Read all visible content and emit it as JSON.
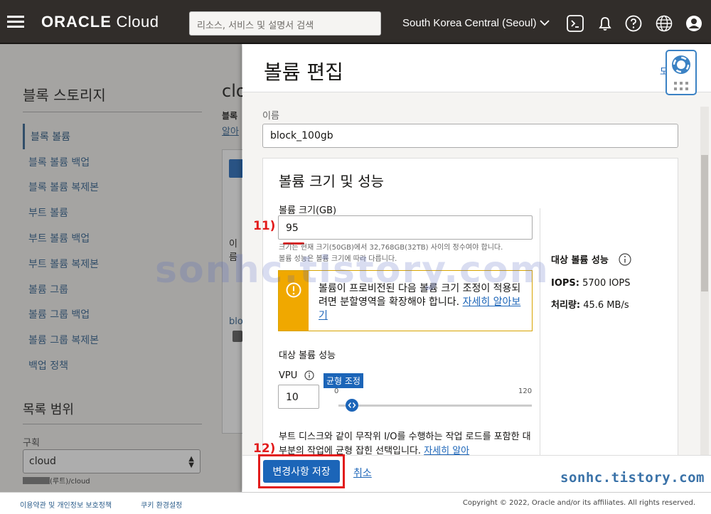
{
  "header": {
    "logo_brand": "ORACLE",
    "logo_product": "Cloud",
    "search_placeholder": "리소스, 서비스 및 설명서 검색",
    "region": "South Korea Central (Seoul)",
    "icons": [
      "cloud-shell-icon",
      "bell-icon",
      "help-icon",
      "globe-icon",
      "user-icon"
    ]
  },
  "sidebar": {
    "title": "블록 스토리지",
    "items": [
      {
        "label": "블록 볼륨",
        "active": true
      },
      {
        "label": "블록 볼륨 백업"
      },
      {
        "label": "블록 볼륨 복제본"
      },
      {
        "label": "부트 볼륨"
      },
      {
        "label": "부트 볼륨 백업"
      },
      {
        "label": "부트 볼륨 복제본"
      },
      {
        "label": "볼륨 그룹"
      },
      {
        "label": "볼륨 그룹 백업"
      },
      {
        "label": "볼륨 그룹 복제본"
      },
      {
        "label": "백업 정책"
      }
    ],
    "scope_title": "목록 범위",
    "compartment_label": "구획",
    "compartment_value": "cloud",
    "compartment_path": "(루트)/cloud"
  },
  "background": {
    "title_partial": "clo",
    "text1": "블록",
    "text2": "알아",
    "col_partial": "이름",
    "row_partial": "blo"
  },
  "panel": {
    "title": "볼륨 편집",
    "name_label": "이름",
    "name_value": "block_100gb",
    "section_title": "볼륨 크기 및 성능",
    "size_label": "볼륨 크기(GB)",
    "size_value": "95",
    "size_hint_line1": "크기는 현재 크기(50GB)에서 32,768GB(32TB) 사이의 정수여야 합니다.",
    "size_hint_line2": "볼륨 성능은 볼륨 크기에 따라 다릅니다.",
    "warning_text": "볼륨이 프로비전된 다음 볼륨 크기 조정이 적용되려면 분할영역을 확장해야 합니다. ",
    "warning_link": "자세히 알아보기",
    "perf_label": "대상 볼륨 성능",
    "vpu_label": "VPU",
    "vpu_value": "10",
    "slider_tooltip": "균형 조정",
    "slider_min": "0",
    "slider_max": "120",
    "slider_value": 10,
    "boot_text": "부트 디스크와 같이 무작위 I/O를 수행하는 작업 로드를 포함한 대부분의 작업에 균형 잡힌 선택입니다. ",
    "boot_link": "자세히 알아",
    "target_title": "대상 볼륨 성능",
    "iops_label": "IOPS:",
    "iops_value": "5700 IOPS",
    "throughput_label": "처리량:",
    "throughput_value": "45.6 MB/s",
    "save_label": "변경사항 저장",
    "cancel_label": "취소",
    "help_partial": "도"
  },
  "annotations": {
    "step11": "11)",
    "step12": "12)"
  },
  "watermarks": {
    "center": "sonhc.tistory.com",
    "corner": "sonhc.tistory.com"
  },
  "footer": {
    "terms": "이용약관 및 개인정보 보호정책",
    "cookies": "쿠키 환경설정",
    "copyright": "Copyright © 2022, Oracle and/or its affiliates. All rights reserved."
  },
  "colors": {
    "header_bg": "#312d2a",
    "accent": "#1c65b8",
    "warning": "#f0a800",
    "annotation": "#e21c1c"
  }
}
